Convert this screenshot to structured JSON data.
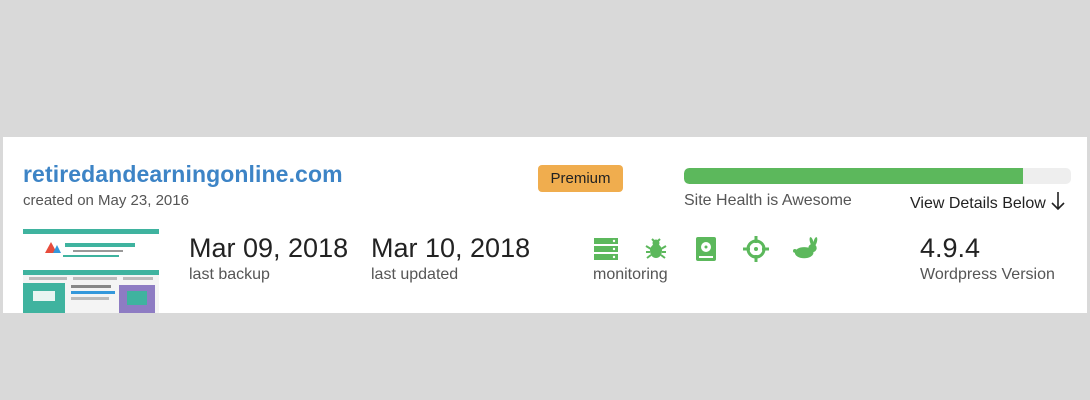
{
  "site": {
    "name": "retiredandearningonline.com",
    "created": "created on May 23, 2016",
    "plan_badge": "Premium"
  },
  "health": {
    "level": 0.875,
    "status_text": "Site Health is Awesome",
    "details_link": "View Details Below",
    "color": "#5cb85c"
  },
  "stats": [
    {
      "value": "Mar 09, 2018",
      "label": "last backup"
    },
    {
      "value": "Mar 10, 2018",
      "label": "last updated"
    }
  ],
  "monitoring": {
    "label": "monitoring",
    "icons": [
      "server-icon",
      "bug-icon",
      "drive-icon",
      "crosshair-icon",
      "rabbit-icon"
    ],
    "color": "#5cb85c"
  },
  "wordpress": {
    "value": "4.9.4",
    "label": "Wordpress Version"
  },
  "thumbnail": {
    "title": "Retired and Earning Online"
  },
  "colors": {
    "accent": "#3d84c6",
    "badge": "#f0ad4e",
    "background": "#d9d9d9"
  }
}
